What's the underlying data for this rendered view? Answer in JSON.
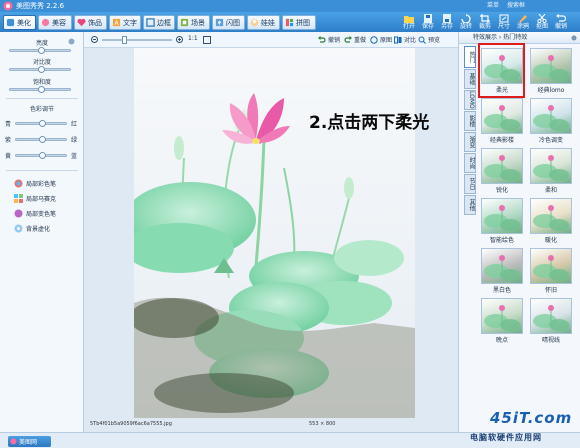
{
  "titlebar": {
    "title": "美图秀秀 2.2.6",
    "links": [
      "菜单",
      "搜索框"
    ]
  },
  "tabs": [
    "美化",
    "美容",
    "饰品",
    "文字",
    "边框",
    "场景",
    "闪图",
    "娃娃",
    "拼图"
  ],
  "right_tools": [
    "打开",
    "保存",
    "另存",
    "旋转",
    "裁剪",
    "尺寸",
    "涂鸦",
    "抠图",
    "撤销"
  ],
  "left_panel": {
    "brightness": "亮度",
    "contrast": "对比度",
    "saturation": "饱和度",
    "color_adjust": "色彩调节",
    "color_pairs": [
      [
        "青",
        "红"
      ],
      [
        "紫",
        "绿"
      ],
      [
        "黄",
        "蓝"
      ]
    ],
    "sliders": {
      "brightness": 0.5,
      "contrast": 0.5,
      "saturation": 0.5,
      "cyan_red": 0.5,
      "purple_green": 0.5,
      "yellow_blue": 0.5
    },
    "brushes": [
      "局部彩色笔",
      "局部马赛克",
      "局部变色笔",
      "背景虚化"
    ]
  },
  "canvas_bar": {
    "zoom_label": "1:1",
    "undo": "撤销",
    "redo": "重做",
    "original": "原图",
    "compare": "对比",
    "preview": "预览"
  },
  "canvas": {
    "overlay_text": "2.点击两下柔光",
    "filename": "5Tb4f01b5a9059f6ac6a7555.jpg",
    "dimensions": "553 × 800"
  },
  "right_panel": {
    "header": "特效展示 › 热门特效",
    "vertical_tabs": [
      "热门",
      "基础",
      "LOMO",
      "影楼",
      "渐变",
      "时尚",
      "节日",
      "其他"
    ],
    "thumbs": [
      {
        "label": "柔光",
        "color": "#d6eaea"
      },
      {
        "label": "经典lomo",
        "color": "#b9c8b2"
      },
      {
        "label": "经典影楼",
        "color": "#dfe9e2"
      },
      {
        "label": "冷色调变",
        "color": "#cfe3ea"
      },
      {
        "label": "锐化",
        "color": "#c4d9c9"
      },
      {
        "label": "柔和",
        "color": "#d9e5d7"
      },
      {
        "label": "智能绘色",
        "color": "#b4dac8"
      },
      {
        "label": "暖化",
        "color": "#e8e0c8"
      },
      {
        "label": "黑白色",
        "color": "#bdbdbd"
      },
      {
        "label": "怀旧",
        "color": "#d6c9a8"
      },
      {
        "label": "晚点",
        "color": "#c9dccb"
      },
      {
        "label": "晴视线",
        "color": "#d8e3e8"
      }
    ]
  },
  "statusbar": {
    "button": "美图网"
  },
  "watermark": {
    "site": "45iT.com",
    "subtitle": "电脑软硬件应用网"
  }
}
